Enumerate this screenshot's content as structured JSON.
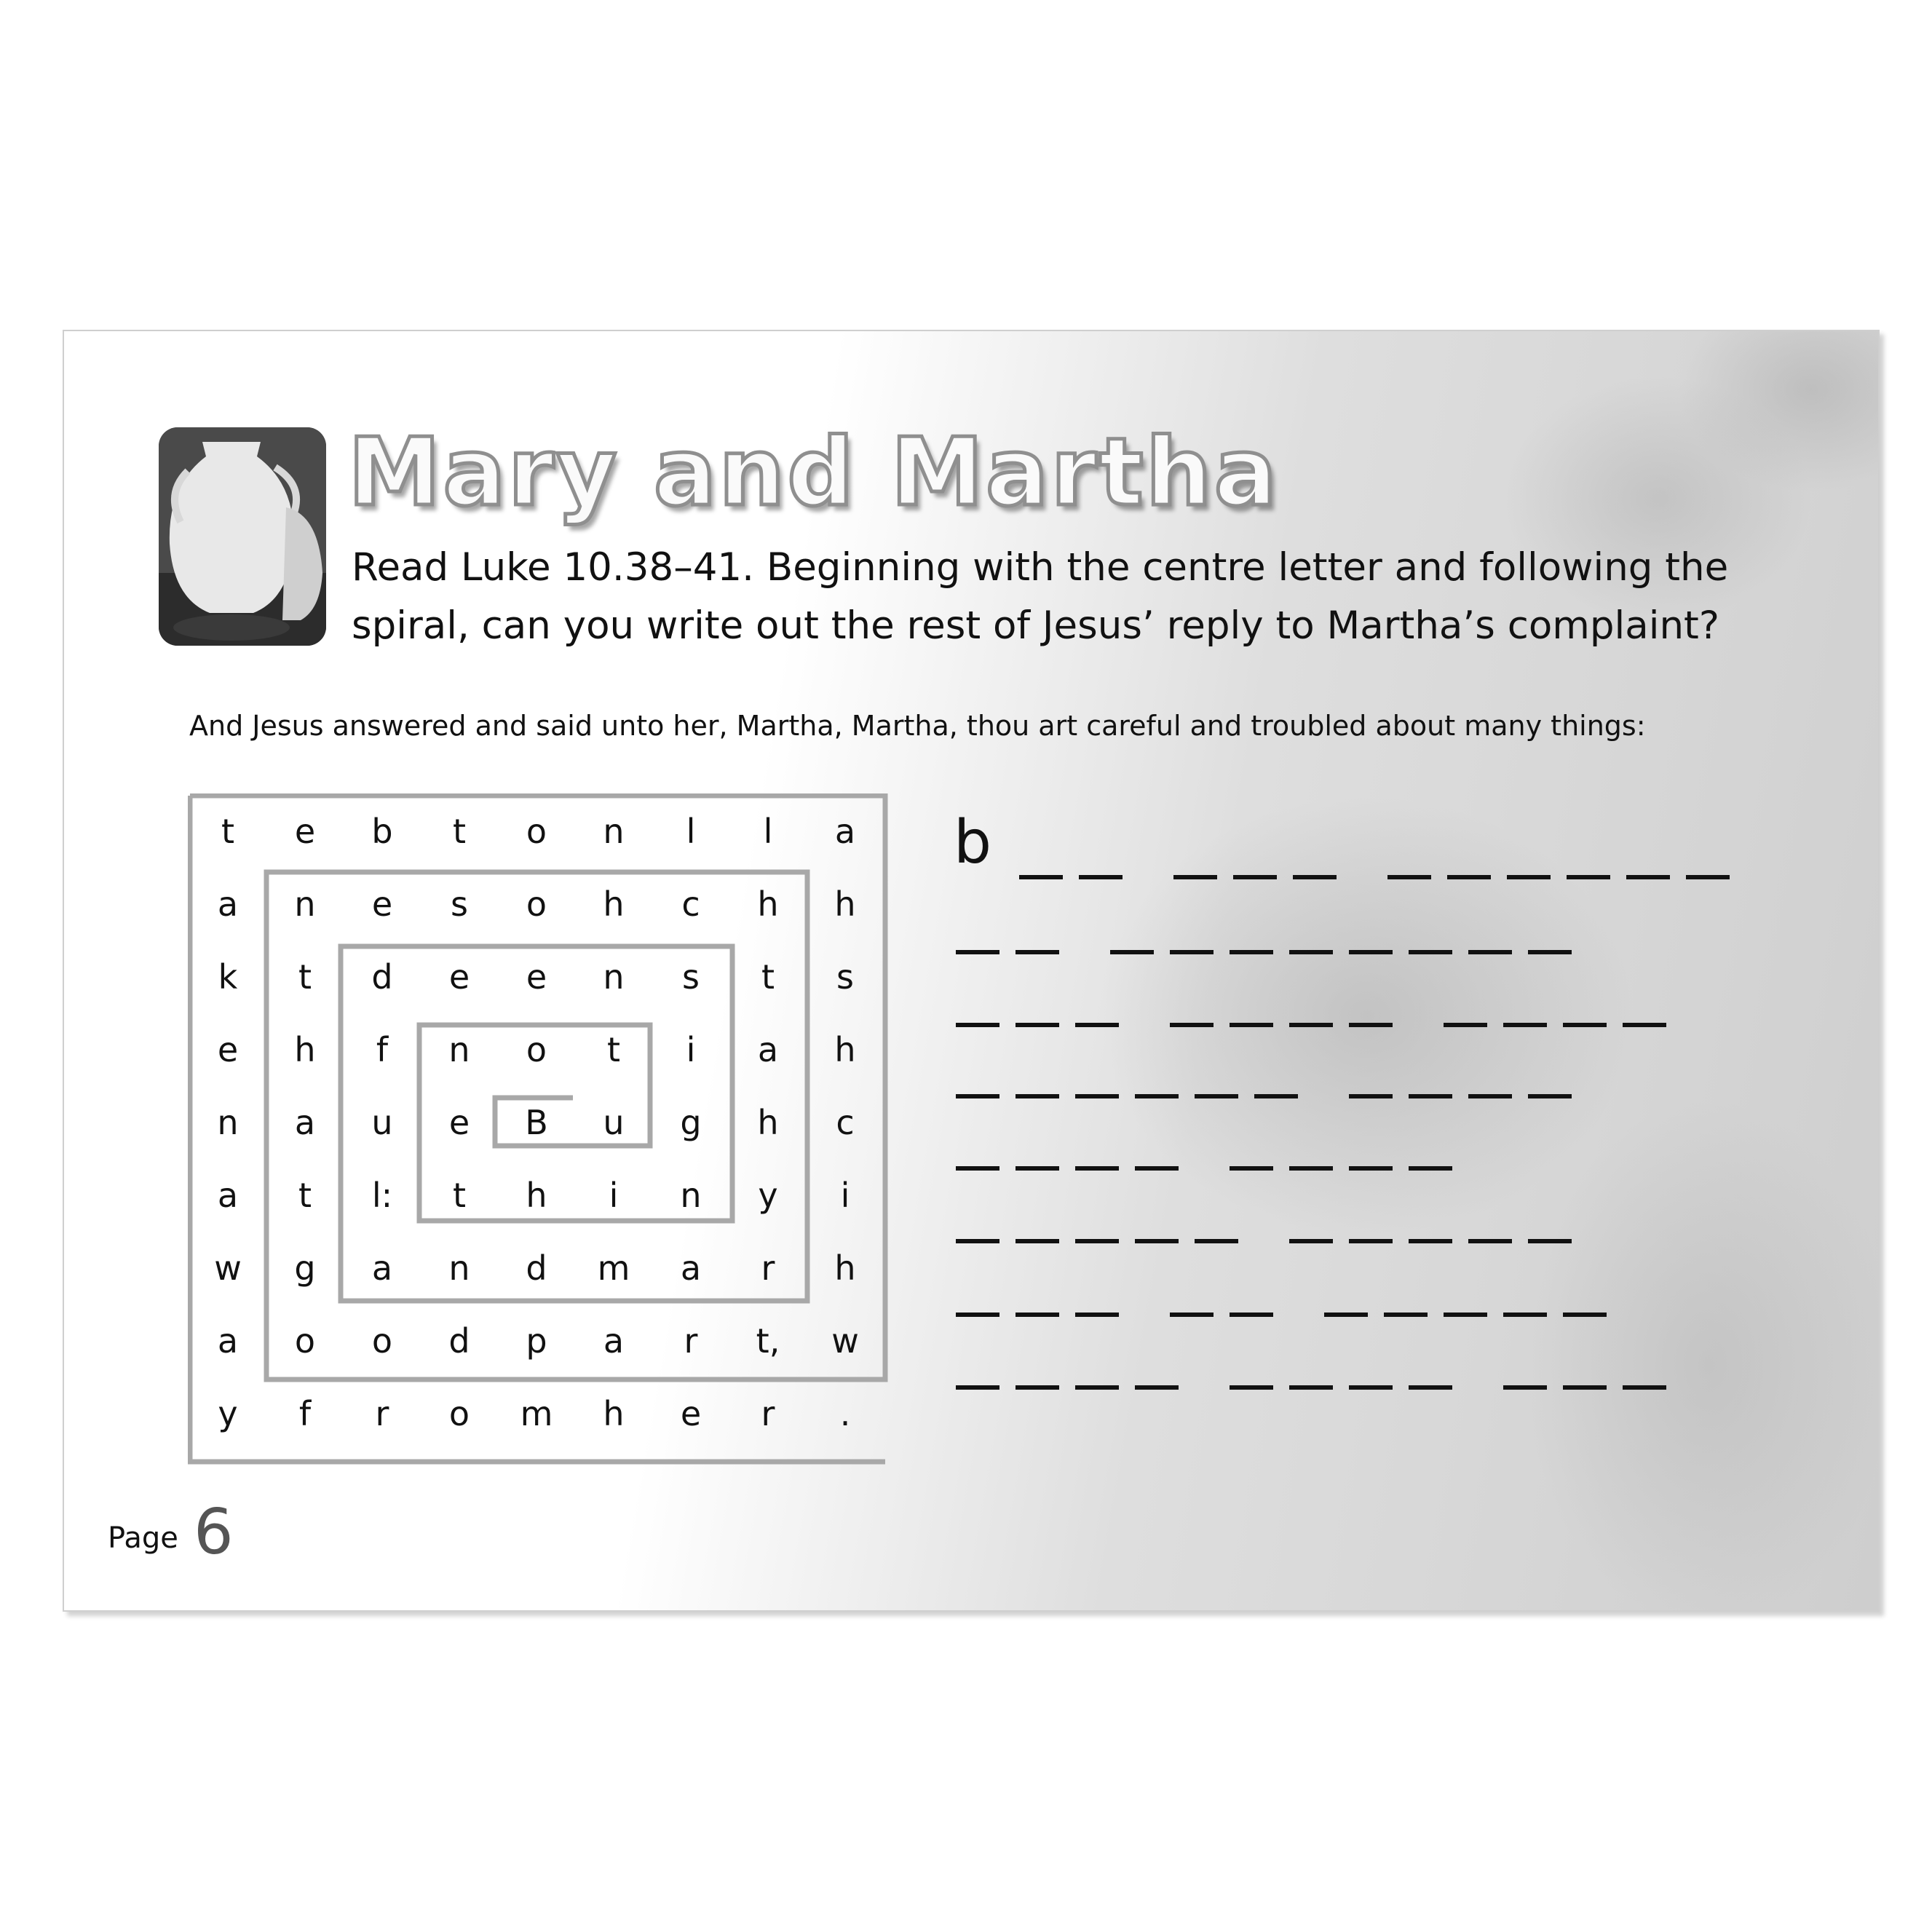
{
  "worksheet": {
    "title": "Mary and Martha",
    "instructions": "Read Luke 10.38–41. Beginning with the centre letter and following the spiral, can you write out the rest of Jesus’ reply to Martha’s complaint?",
    "quote": "And Jesus answered and said unto her, Martha, Martha, thou art careful and troubled about many things:",
    "grid": [
      [
        "t",
        "e",
        "b",
        "t",
        "o",
        "n",
        "l",
        "l",
        "a"
      ],
      [
        "a",
        "n",
        "e",
        "s",
        "o",
        "h",
        "c",
        "h",
        "h"
      ],
      [
        "k",
        "t",
        "d",
        "e",
        "e",
        "n",
        "s",
        "t",
        "s"
      ],
      [
        "e",
        "h",
        "f",
        "n",
        "o",
        "t",
        "i",
        "a",
        "h"
      ],
      [
        "n",
        "a",
        "u",
        "e",
        "B",
        "u",
        "g",
        "h",
        "c"
      ],
      [
        "a",
        "t",
        "l:",
        "t",
        "h",
        "i",
        "n",
        "y",
        "i"
      ],
      [
        "w",
        "g",
        "a",
        "n",
        "d",
        "m",
        "a",
        "r",
        "h"
      ],
      [
        "a",
        "o",
        "o",
        "d",
        "p",
        "a",
        "r",
        "t,",
        "w"
      ],
      [
        "y",
        "f",
        "r",
        "o",
        "m",
        "h",
        "e",
        "r",
        "."
      ]
    ],
    "answer_first_letter": "b",
    "answer_word_lengths": [
      [
        2,
        3,
        6
      ],
      [
        2,
        8
      ],
      [
        3,
        4,
        4
      ],
      [
        6,
        4
      ],
      [
        4,
        4
      ],
      [
        5,
        5
      ],
      [
        3,
        2,
        5
      ],
      [
        4,
        4,
        3
      ]
    ],
    "page_label": "Page",
    "page_number": "6"
  }
}
